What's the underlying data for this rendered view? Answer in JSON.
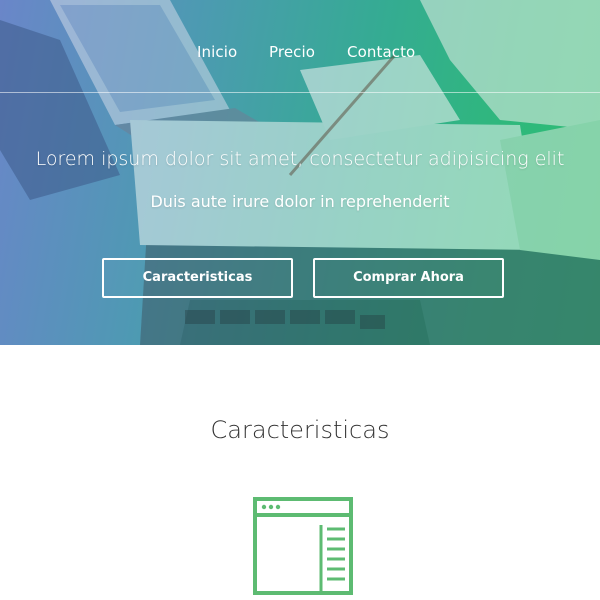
{
  "colors": {
    "hero_gradient_start": "#6a86c9",
    "hero_gradient_end": "#2cbd72",
    "accent_green": "#5dbb72",
    "text_dark": "#333333"
  },
  "nav": {
    "items": [
      {
        "label": "Inicio"
      },
      {
        "label": "Precio"
      },
      {
        "label": "Contacto"
      }
    ]
  },
  "hero": {
    "title": "Lorem ipsum dolor sit amet, consectetur adipisicing elit",
    "subtitle": "Duis aute irure dolor in reprehenderit",
    "buttons": [
      {
        "label": "Caracteristicas"
      },
      {
        "label": "Comprar Ahora"
      }
    ]
  },
  "features": {
    "title": "Caracteristicas",
    "icon": "browser-window-icon"
  }
}
